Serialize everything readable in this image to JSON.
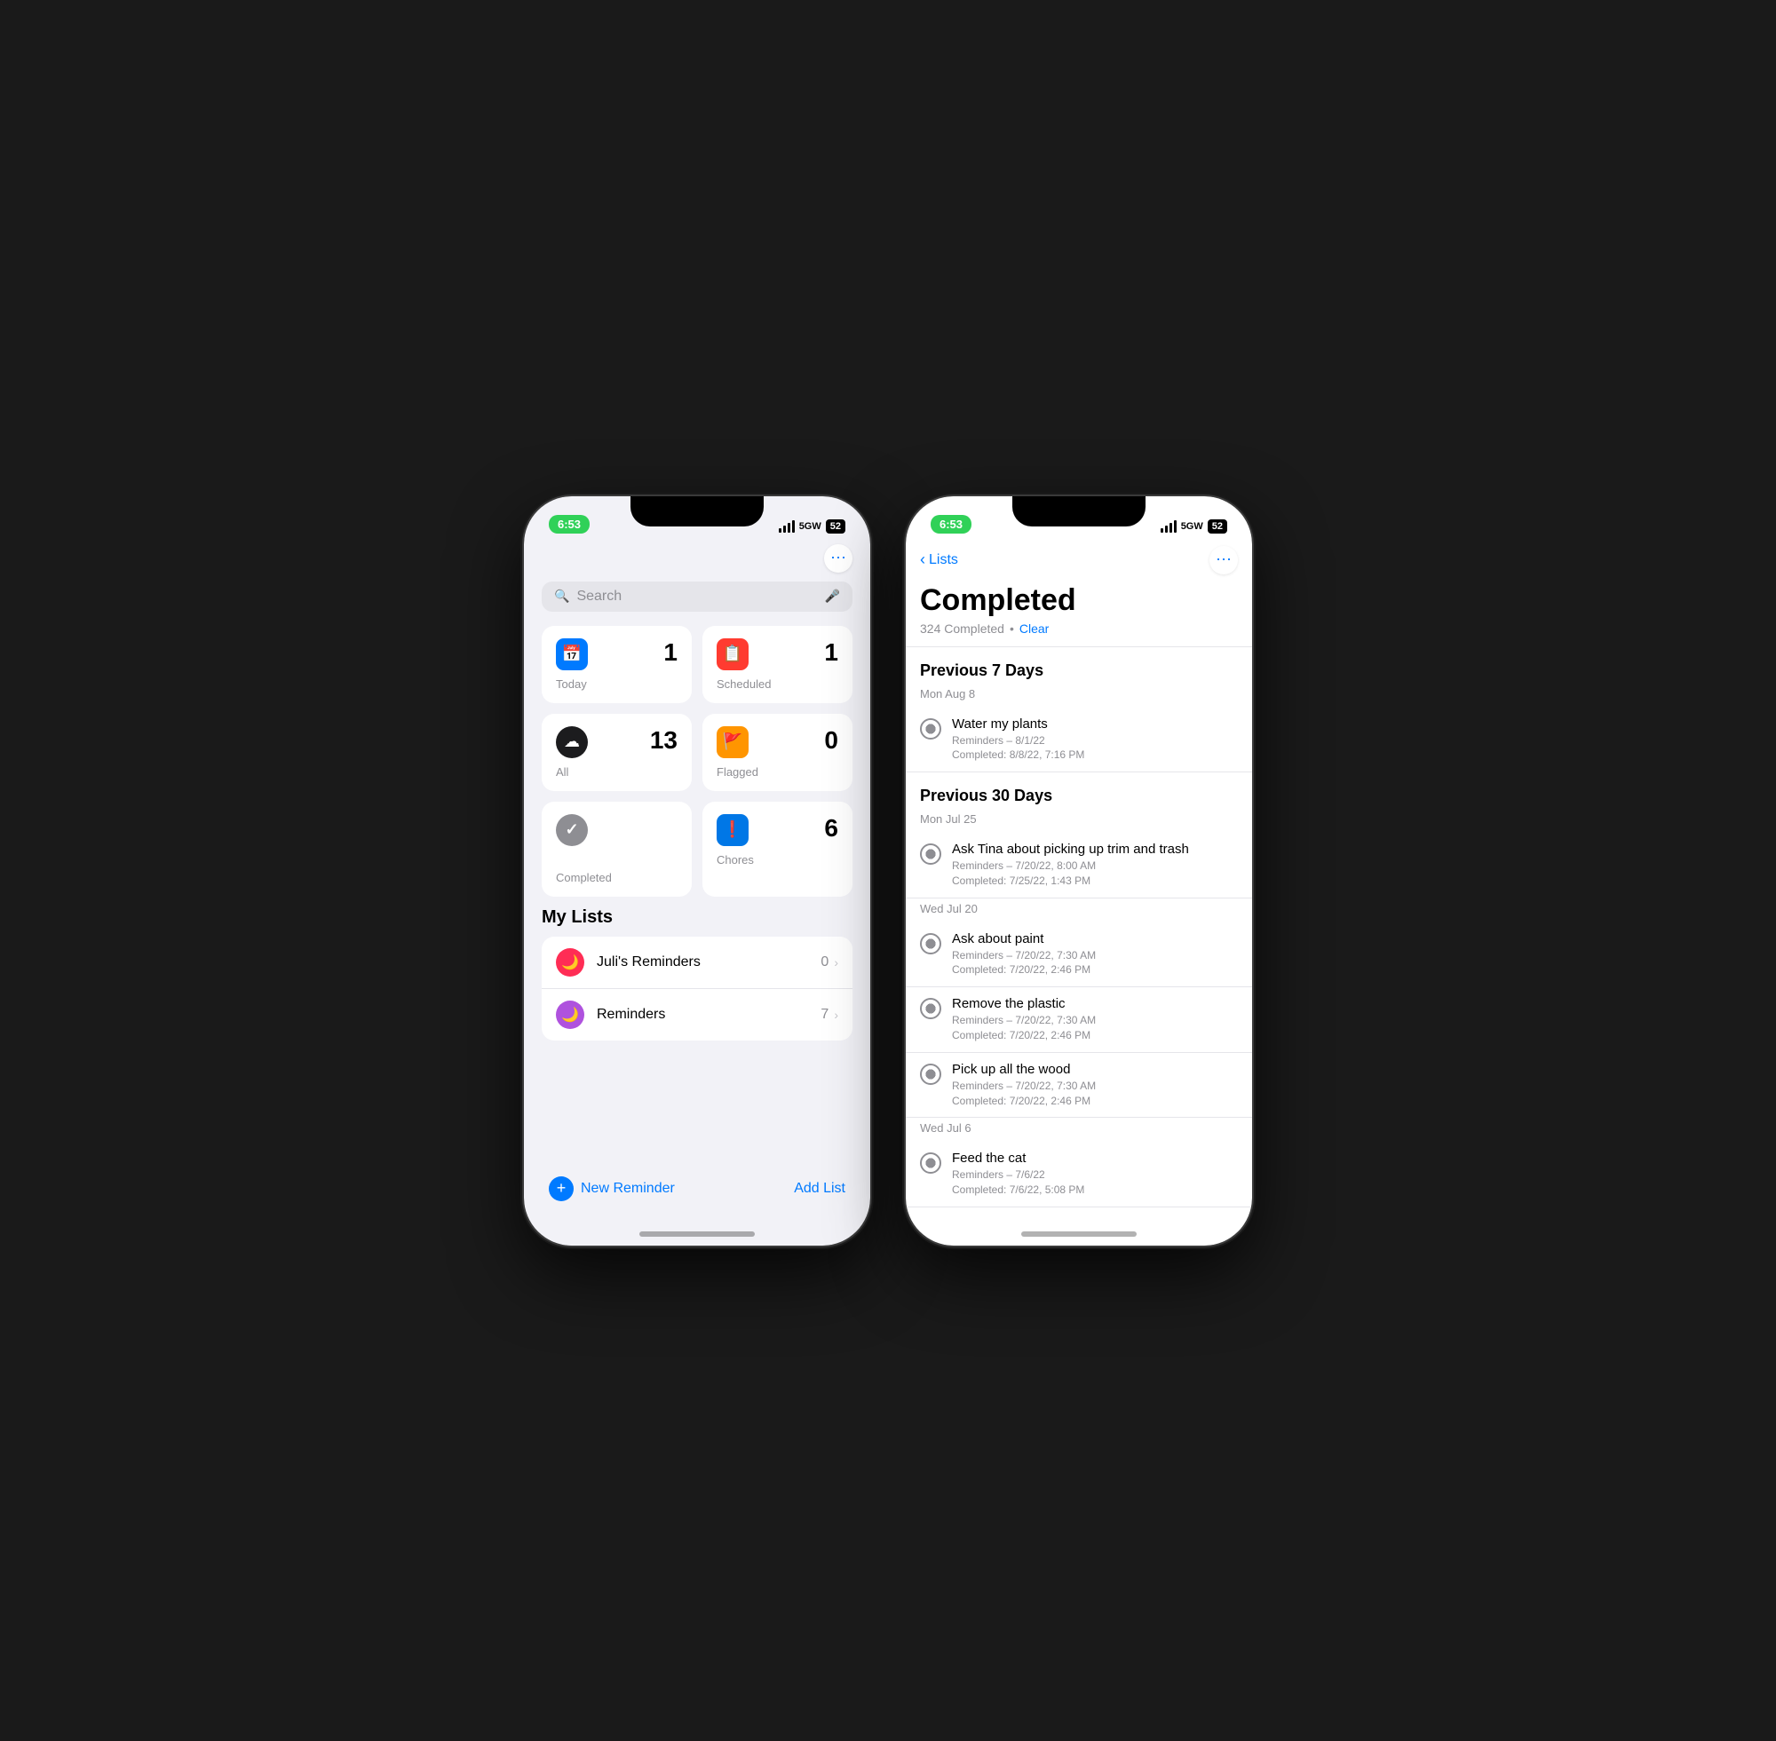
{
  "left_phone": {
    "status_time": "6:53",
    "status_signal": "5GW",
    "status_battery": "52",
    "more_icon": "⋯",
    "search": {
      "placeholder": "Search",
      "mic_icon": "🎤"
    },
    "cards": [
      {
        "id": "today",
        "label": "Today",
        "count": "1",
        "icon_color": "icon-blue",
        "icon": "📅"
      },
      {
        "id": "scheduled",
        "label": "Scheduled",
        "count": "1",
        "icon_color": "icon-red",
        "icon": "📋"
      },
      {
        "id": "all",
        "label": "All",
        "count": "13",
        "icon_color": "icon-black",
        "icon": "☁"
      },
      {
        "id": "flagged",
        "label": "Flagged",
        "count": "0",
        "icon_color": "icon-orange",
        "icon": "🚩"
      },
      {
        "id": "completed",
        "label": "Completed",
        "count": "",
        "icon_color": "icon-gray",
        "icon": "✓"
      },
      {
        "id": "chores",
        "label": "Chores",
        "count": "6",
        "icon_color": "icon-blue2",
        "icon": "❗"
      }
    ],
    "my_lists": {
      "title": "My Lists",
      "items": [
        {
          "name": "Juli's Reminders",
          "count": "0",
          "icon_bg": "#ff2d55",
          "icon": "🌙"
        },
        {
          "name": "Reminders",
          "count": "7",
          "icon_bg": "#af52de",
          "icon": "🌙"
        }
      ]
    },
    "bottom": {
      "new_reminder": "New Reminder",
      "add_list": "Add List"
    }
  },
  "right_phone": {
    "status_time": "6:53",
    "status_signal": "5GW",
    "status_battery": "52",
    "nav": {
      "back_label": "Lists",
      "more_icon": "⋯"
    },
    "title": "Completed",
    "subtitle_count": "324 Completed",
    "subtitle_dot": "•",
    "clear_label": "Clear",
    "sections": [
      {
        "title": "Previous 7 Days",
        "date_groups": [
          {
            "date": "Mon Aug 8",
            "items": [
              {
                "title": "Water my plants",
                "reminder_line": "Reminders – 8/1/22",
                "completed_line": "Completed: 8/8/22, 7:16 PM"
              }
            ]
          }
        ]
      },
      {
        "title": "Previous 30 Days",
        "date_groups": [
          {
            "date": "Mon Jul 25",
            "items": [
              {
                "title": "Ask Tina about picking up trim and trash",
                "reminder_line": "Reminders – 7/20/22, 8:00 AM",
                "completed_line": "Completed: 7/25/22, 1:43 PM"
              }
            ]
          },
          {
            "date": "Wed Jul 20",
            "items": [
              {
                "title": "Ask about paint",
                "reminder_line": "Reminders – 7/20/22, 7:30 AM",
                "completed_line": "Completed: 7/20/22, 2:46 PM"
              },
              {
                "title": "Remove the plastic",
                "reminder_line": "Reminders – 7/20/22, 7:30 AM",
                "completed_line": "Completed: 7/20/22, 2:46 PM"
              },
              {
                "title": "Pick up all the wood",
                "reminder_line": "Reminders – 7/20/22, 7:30 AM",
                "completed_line": "Completed: 7/20/22, 2:46 PM"
              }
            ]
          },
          {
            "date": "Wed Jul 6",
            "items": [
              {
                "title": "Feed the cat",
                "reminder_line": "Reminders – 7/6/22",
                "completed_line": "Completed: 7/6/22, 5:08 PM"
              }
            ]
          }
        ]
      }
    ]
  }
}
